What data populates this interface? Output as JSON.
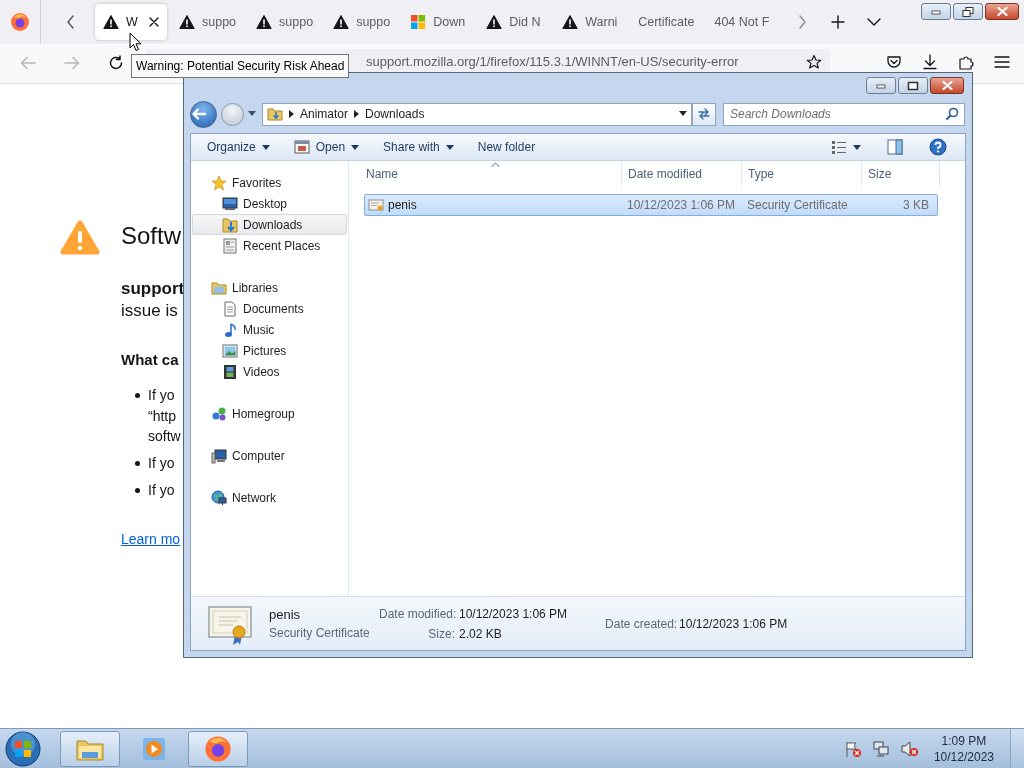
{
  "browser": {
    "tabs": [
      {
        "label": "W",
        "kind": "warning",
        "selected": true
      },
      {
        "label": "suppo",
        "kind": "warning",
        "selected": false
      },
      {
        "label": "suppo",
        "kind": "warning",
        "selected": false
      },
      {
        "label": "suppo",
        "kind": "warning",
        "selected": false
      },
      {
        "label": "Down",
        "kind": "windows",
        "selected": false
      },
      {
        "label": "Did N",
        "kind": "warning",
        "selected": false
      },
      {
        "label": "Warni",
        "kind": "warning",
        "selected": false
      },
      {
        "label": "Certificate",
        "kind": "plain",
        "selected": false
      },
      {
        "label": "404 Not F",
        "kind": "plain",
        "selected": false
      }
    ],
    "tooltip": "Warning: Potential Security Risk Ahead",
    "url": "support.mozilla.org/1/firefox/115.3.1/WINNT/en-US/security-error",
    "page": {
      "title": "Softw",
      "host": "support",
      "line": "issue is",
      "heading": "What ca",
      "bullets": [
        "If yo\n“http\nsoftw",
        "If yo",
        "If yo"
      ],
      "link": "Learn mo"
    }
  },
  "explorer": {
    "breadcrumb": [
      "Animator",
      "Downloads"
    ],
    "search": {
      "placeholder": "Search Downloads"
    },
    "commands": [
      {
        "label": "Organize",
        "kind": "plain",
        "dropdown": true
      },
      {
        "label": "Open",
        "kind": "open",
        "dropdown": true
      },
      {
        "label": "Share with",
        "kind": "plain",
        "dropdown": true
      },
      {
        "label": "New folder",
        "kind": "plain",
        "dropdown": false
      }
    ],
    "nav": [
      {
        "label": "Favorites",
        "kind": "star",
        "selected": false,
        "children": [
          {
            "label": "Desktop",
            "kind": "desktop",
            "selected": false
          },
          {
            "label": "Downloads",
            "kind": "downloads",
            "selected": true
          },
          {
            "label": "Recent Places",
            "kind": "recent",
            "selected": false
          }
        ]
      },
      {
        "label": "Libraries",
        "kind": "libraries",
        "selected": false,
        "children": [
          {
            "label": "Documents",
            "kind": "documents",
            "selected": false
          },
          {
            "label": "Music",
            "kind": "music",
            "selected": false
          },
          {
            "label": "Pictures",
            "kind": "pictures",
            "selected": false
          },
          {
            "label": "Videos",
            "kind": "videos",
            "selected": false
          }
        ]
      },
      {
        "label": "Homegroup",
        "kind": "homegroup",
        "selected": false
      },
      {
        "label": "Computer",
        "kind": "computer",
        "selected": false
      },
      {
        "label": "Network",
        "kind": "network",
        "selected": false
      }
    ],
    "columns": [
      {
        "label": "Name",
        "sorted": true
      },
      {
        "label": "Date modified",
        "sorted": false
      },
      {
        "label": "Type",
        "sorted": false
      },
      {
        "label": "Size",
        "sorted": false
      }
    ],
    "files": [
      {
        "name": "penis",
        "date_modified": "10/12/2023 1:06 PM",
        "type": "Security Certificate",
        "size": "3 KB",
        "selected": true
      }
    ],
    "details": {
      "name": "penis",
      "type": "Security Certificate",
      "fields": [
        [
          {
            "label": "Date modified:",
            "value": "10/12/2023 1:06 PM"
          },
          {
            "label": "Size:",
            "value": "2.02 KB"
          }
        ],
        [
          {
            "label": "Date created:",
            "value": "10/12/2023 1:06 PM"
          }
        ]
      ]
    }
  },
  "taskbar": {
    "items": [
      {
        "kind": "explorer",
        "open": true
      },
      {
        "kind": "media",
        "open": false
      },
      {
        "kind": "firefox",
        "open": true
      }
    ],
    "clock": {
      "time": "1:09 PM",
      "date": "10/12/2023"
    }
  }
}
